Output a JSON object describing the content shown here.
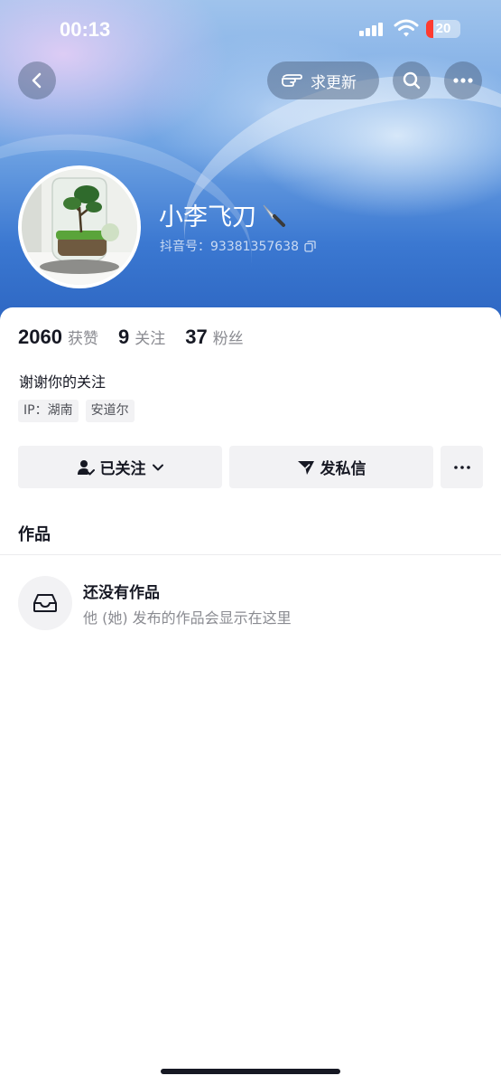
{
  "status_bar": {
    "time": "00:13",
    "battery_level": "20",
    "battery_color": "#ff3b30"
  },
  "nav": {
    "back_icon": "chevron-left-icon",
    "request_update_label": "求更新",
    "request_update_icon": "pointing-hand-icon",
    "search_icon": "search-icon",
    "more_icon": "more-dots-icon"
  },
  "profile": {
    "nickname": "小李飞刀",
    "nickname_emoji": "🔪",
    "douyin_id": "抖音号：93381357638",
    "copy_icon": "copy-icon"
  },
  "stats": [
    {
      "value": "2060",
      "label": "获赞"
    },
    {
      "value": "9",
      "label": "关注"
    },
    {
      "value": "37",
      "label": "粉丝"
    }
  ],
  "bio": "谢谢你的关注",
  "tags": [
    "IP：湖南",
    "安道尔"
  ],
  "actions": {
    "follow_label": "已关注",
    "message_label": "发私信"
  },
  "tabs": {
    "works_label": "作品"
  },
  "empty_state": {
    "title": "还没有作品",
    "description": "他 (她) 发布的作品会显示在这里"
  },
  "colors": {
    "banner_blue": "#3b78d1",
    "text_primary": "#161823",
    "text_secondary": "#8a8b91",
    "button_bg": "#f2f2f4"
  }
}
